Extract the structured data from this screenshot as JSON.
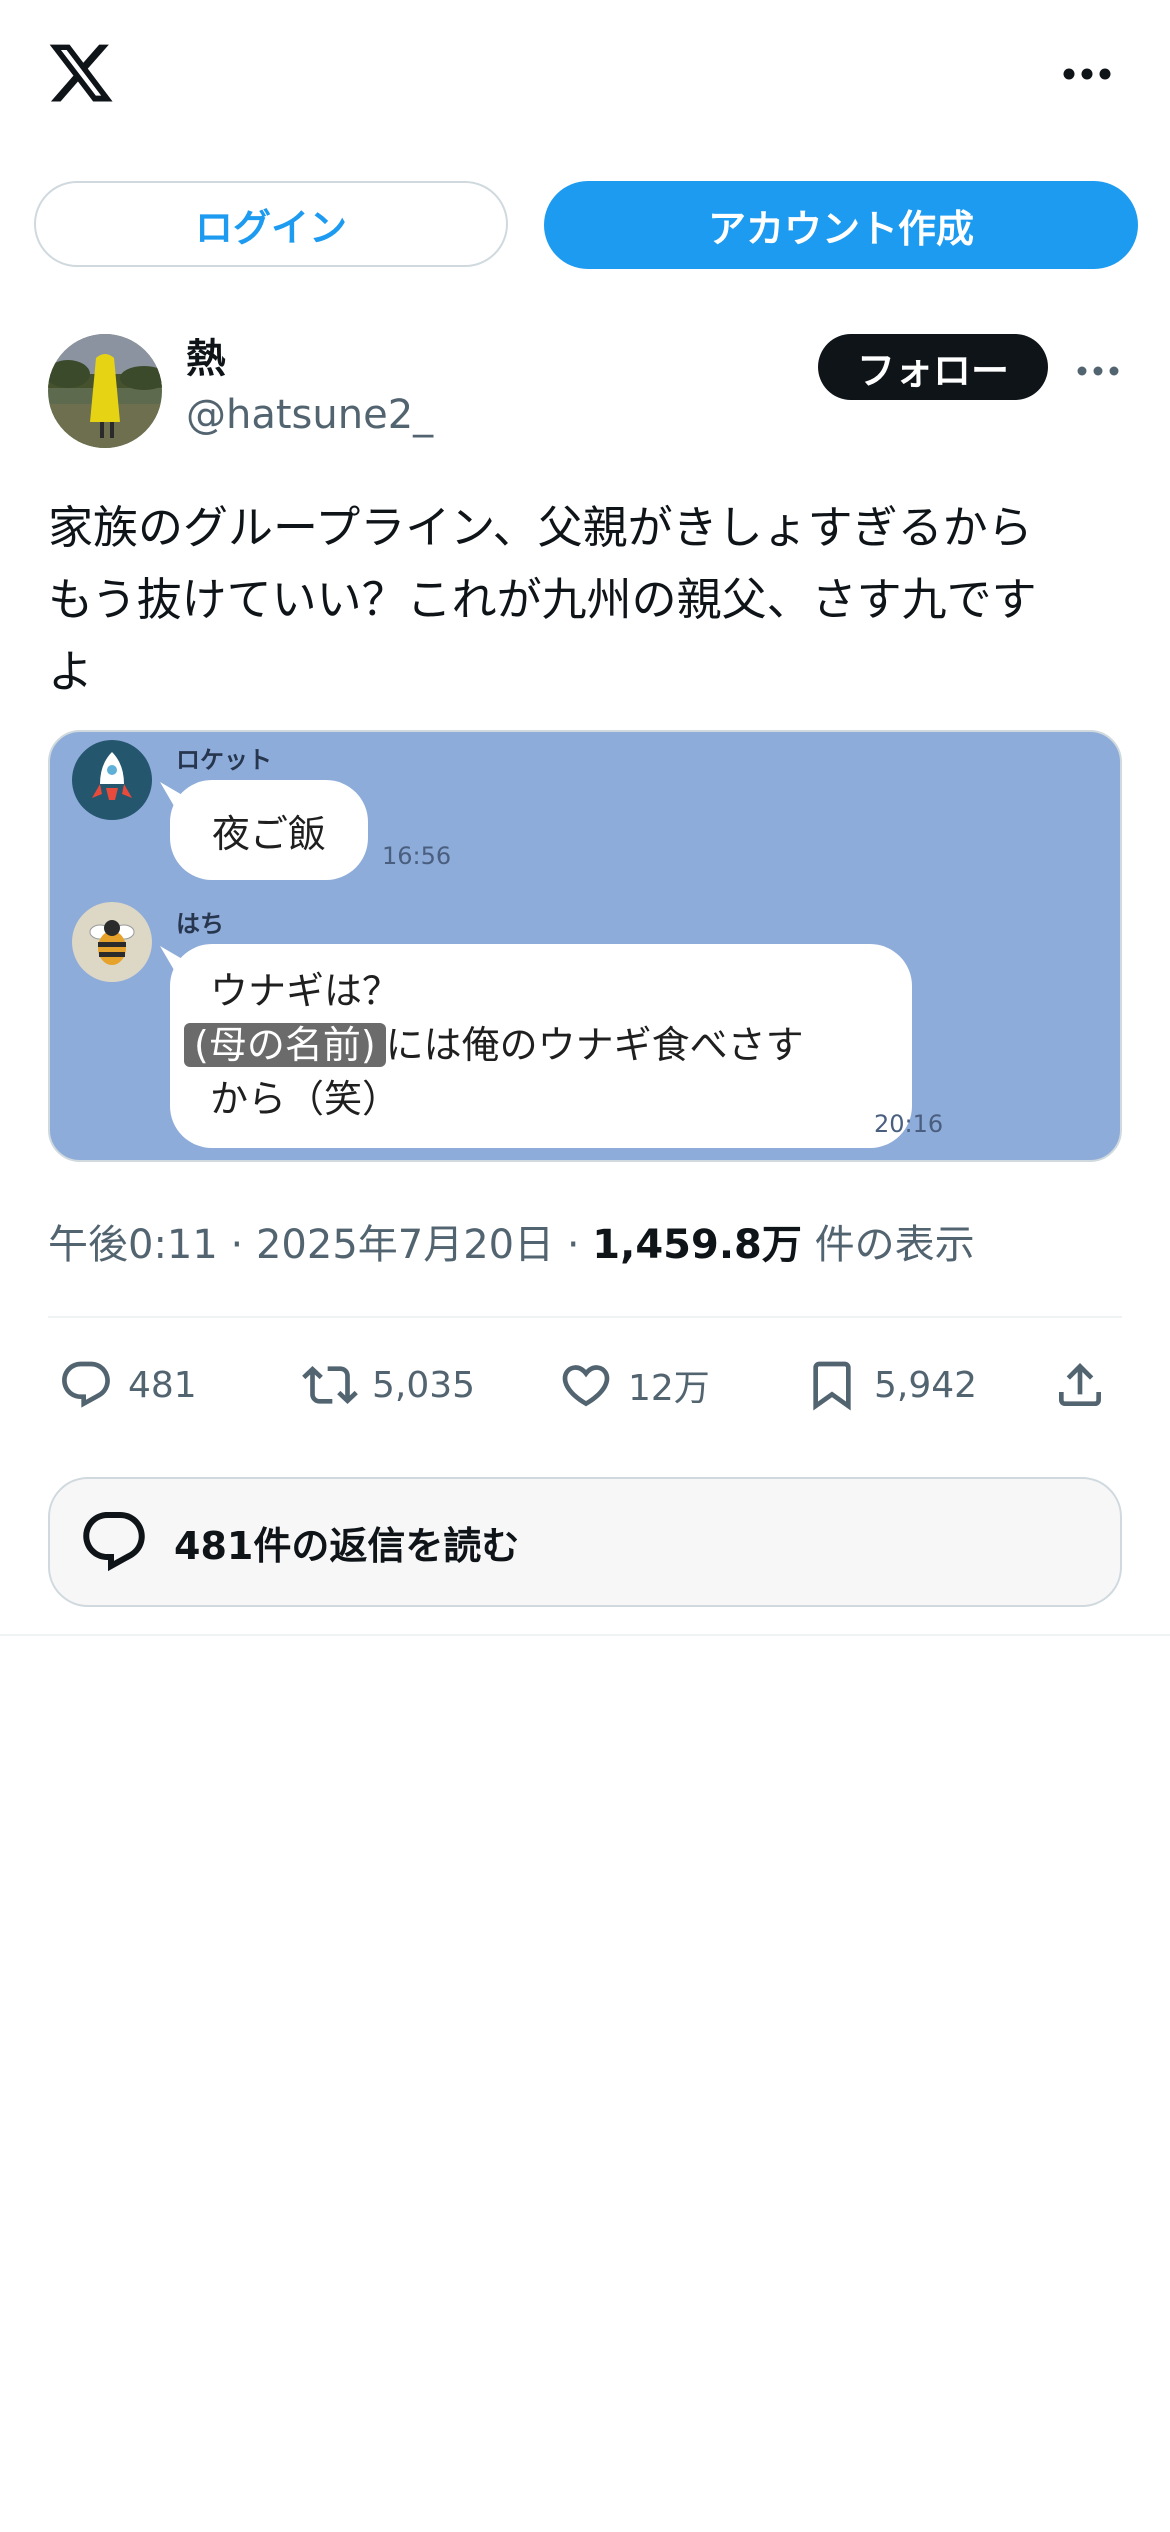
{
  "header": {
    "logo_icon": "x-logo-icon",
    "more_icon": "more-horizontal-icon"
  },
  "auth": {
    "login_label": "ログイン",
    "signup_label": "アカウント作成"
  },
  "author": {
    "name": "熱",
    "handle": "@hatsune2_",
    "follow_label": "フォロー"
  },
  "tweet": {
    "text": "家族のグループライン、父親がきしょすぎるから\nもう抜けていい？これが九州の親父、さす九です\nよ"
  },
  "media": {
    "messages": [
      {
        "sender": "ロケット",
        "text": "夜ご飯",
        "time": "16:56"
      },
      {
        "sender": "はち",
        "line1": "ウナギは？",
        "masked": "(母の名前)",
        "line2_rest": "には俺のウナギ食べさす",
        "line3": "から（笑）",
        "time": "20:16"
      }
    ]
  },
  "meta": {
    "time": "午後0:11",
    "sep": "·",
    "date": "2025年7月20日",
    "views": "1,459.8万",
    "views_label": "件の表示"
  },
  "actions": {
    "replies": "481",
    "reposts": "5,035",
    "likes": "12万",
    "bookmarks": "5,942"
  },
  "read_replies": {
    "label": "481件の返信を読む"
  },
  "colors": {
    "accent": "#1d9bf0",
    "text": "#0f1419",
    "secondary": "#536471",
    "chat_bg": "#8eacd9"
  }
}
